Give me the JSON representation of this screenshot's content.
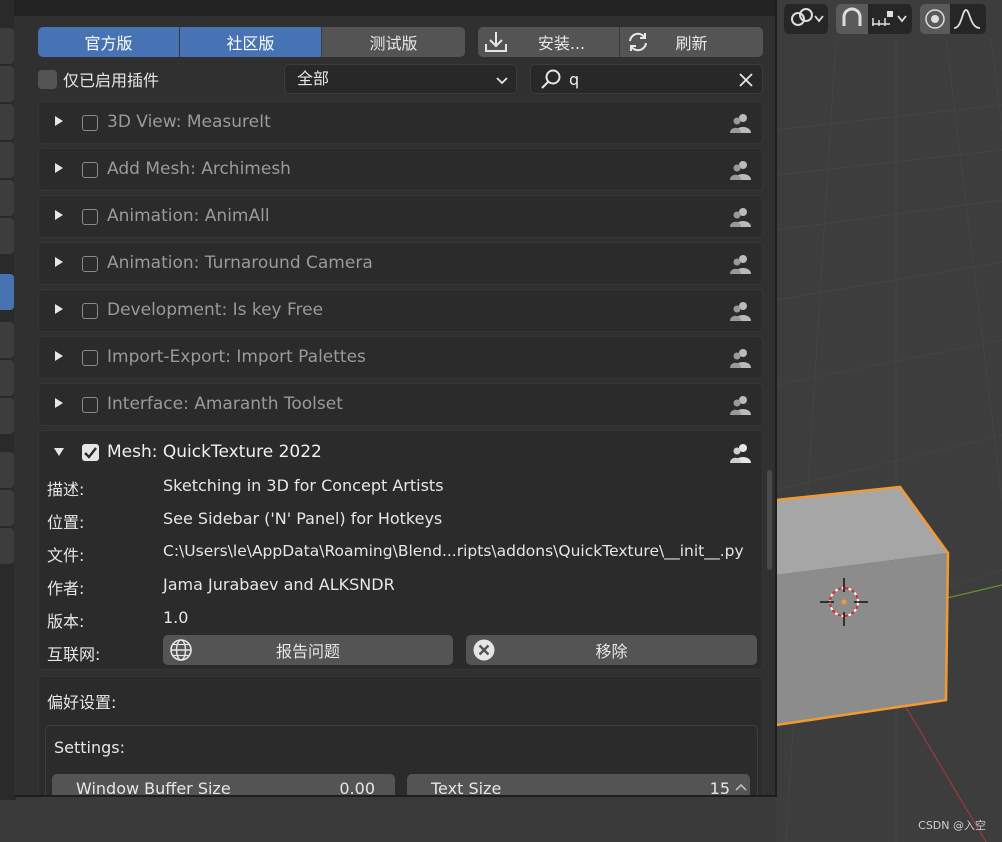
{
  "tabs": {
    "official": "官方版",
    "community": "社区版",
    "testing": "测试版",
    "install": "安装...",
    "refresh": "刷新"
  },
  "filter": {
    "enabled_only_label": "仅已启用插件",
    "category_value": "全部",
    "search_value": "q"
  },
  "addons": [
    {
      "name": "3D View: MeasureIt"
    },
    {
      "name": "Add Mesh: Archimesh"
    },
    {
      "name": "Animation: AnimAll"
    },
    {
      "name": "Animation: Turnaround Camera"
    },
    {
      "name": "Development: Is key Free"
    },
    {
      "name": "Import-Export: Import Palettes"
    },
    {
      "name": "Interface: Amaranth Toolset"
    }
  ],
  "expanded_addon": {
    "name": "Mesh: QuickTexture 2022",
    "enabled": true,
    "desc_label": "描述:",
    "desc_value": "Sketching in 3D for Concept Artists",
    "location_label": "位置:",
    "location_value": "See Sidebar ('N' Panel) for Hotkeys",
    "file_label": "文件:",
    "file_value": "C:\\Users\\le\\AppData\\Roaming\\Blend...ripts\\addons\\QuickTexture\\__init__.py",
    "author_label": "作者:",
    "author_value": "Jama Jurabaev and ALKSNDR",
    "version_label": "版本:",
    "version_value": "1.0",
    "internet_label": "互联网:",
    "report_button": "报告问题",
    "remove_button": "移除"
  },
  "preferences": {
    "section_label": "偏好设置:",
    "settings_label": "Settings:",
    "window_buffer_label": "Window Buffer Size",
    "window_buffer_value": "0.00",
    "text_size_label": "Text Size",
    "text_size_value": "15"
  },
  "watermark": "CSDN @入空",
  "colors": {
    "accent": "#4772b3",
    "cube_outline": "#f19a35",
    "axis_red": "#a0363f",
    "axis_green": "#6a8f2c"
  }
}
